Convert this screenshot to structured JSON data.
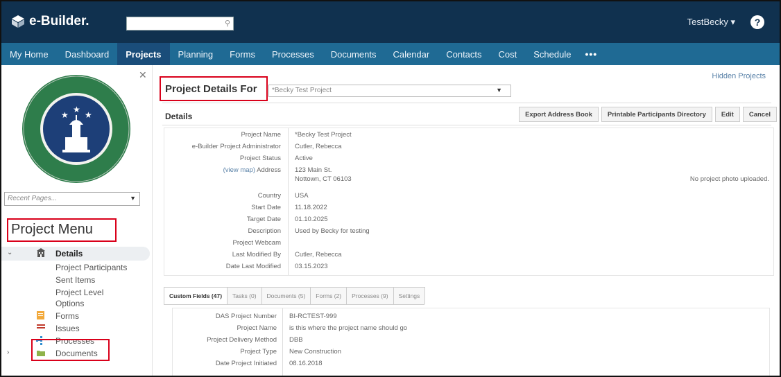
{
  "app": {
    "logo_text": "e-Builder."
  },
  "header": {
    "user": "TestBecky ▾",
    "help": "?"
  },
  "nav": {
    "items": [
      "My Home",
      "Dashboard",
      "Projects",
      "Planning",
      "Forms",
      "Processes",
      "Documents",
      "Calendar",
      "Contacts",
      "Cost",
      "Schedule"
    ],
    "active_index": 2,
    "more": "•••"
  },
  "sidebar": {
    "recent_placeholder": "Recent Pages...",
    "project_menu_title": "Project Menu",
    "menu": {
      "details": "Details",
      "participants": "Project Participants",
      "sent_items": "Sent Items",
      "level_options_1": "Project Level",
      "level_options_2": "Options",
      "forms": "Forms",
      "issues": "Issues",
      "processes": "Processes",
      "documents": "Documents"
    }
  },
  "main": {
    "hidden_projects": "Hidden Projects",
    "project_details_for": "Project Details For",
    "project_select": "*Becky Test Project",
    "details_heading": "Details",
    "buttons": {
      "export": "Export Address Book",
      "printable": "Printable Participants Directory",
      "edit": "Edit",
      "cancel": "Cancel"
    },
    "fields": [
      {
        "label": "Project Name",
        "value": "*Becky Test Project"
      },
      {
        "label": "e-Builder Project Administrator",
        "value": "Cutler, Rebecca"
      },
      {
        "label": "Project Status",
        "value": "Active"
      },
      {
        "label": "Address",
        "value": "123 Main St."
      },
      {
        "label": "",
        "value": "Nottown, CT 06103"
      },
      {
        "label": "Country",
        "value": "USA"
      },
      {
        "label": "Start Date",
        "value": "11.18.2022"
      },
      {
        "label": "Target Date",
        "value": "01.10.2025"
      },
      {
        "label": "Description",
        "value": "Used by Becky for testing"
      },
      {
        "label": "Project Webcam",
        "value": ""
      },
      {
        "label": "Last Modified By",
        "value": "Cutler, Rebecca"
      },
      {
        "label": "Date Last Modified",
        "value": "03.15.2023"
      }
    ],
    "view_map": "(view map)",
    "no_photo": "No project photo uploaded.",
    "tabs": [
      "Custom Fields (47)",
      "Tasks (0)",
      "Documents (5)",
      "Forms (2)",
      "Processes (9)",
      "Settings"
    ],
    "custom_fields": [
      {
        "label": "DAS Project Number",
        "value": "BI-RCTEST-999"
      },
      {
        "label": "Project Name",
        "value": "is this where the project name should go"
      },
      {
        "label": "Project Delivery Method",
        "value": "DBB"
      },
      {
        "label": "Project Type",
        "value": "New Construction"
      },
      {
        "label": "Date Project Initiated",
        "value": "08.16.2018"
      }
    ]
  },
  "colors": {
    "topbar": "#10314f",
    "nav": "#1f6a94",
    "nav_active": "#1a4d7a",
    "highlight": "#d9001a"
  }
}
